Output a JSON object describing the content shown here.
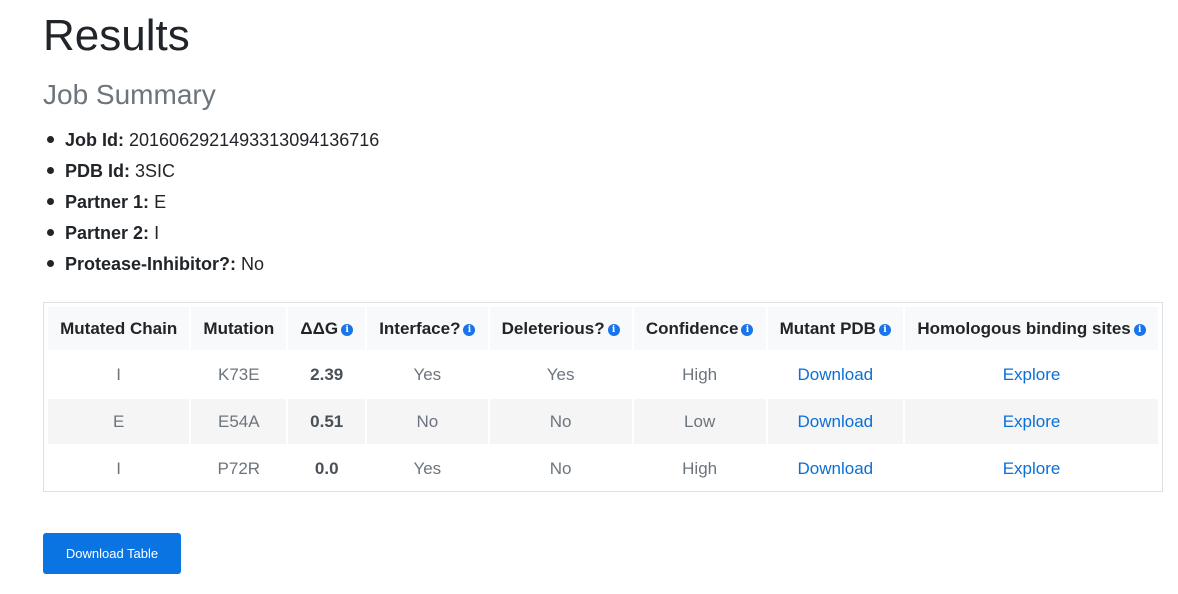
{
  "page": {
    "title": "Results",
    "section_title": "Job Summary"
  },
  "summary": [
    {
      "label": "Job Id:",
      "value": "20160629214933130941367​16"
    },
    {
      "label": "PDB Id:",
      "value": "3SIC"
    },
    {
      "label": "Partner 1:",
      "value": "E"
    },
    {
      "label": "Partner 2:",
      "value": "I"
    },
    {
      "label": "Protease-Inhibitor?:",
      "value": "No"
    }
  ],
  "table": {
    "headers": [
      {
        "label": "Mutated Chain",
        "info": false
      },
      {
        "label": "Mutation",
        "info": false
      },
      {
        "label": "ΔΔG",
        "info": true
      },
      {
        "label": "Interface?",
        "info": true
      },
      {
        "label": "Deleterious?",
        "info": true
      },
      {
        "label": "Confidence",
        "info": true
      },
      {
        "label": "Mutant PDB",
        "info": true
      },
      {
        "label": "Homologous binding sites",
        "info": true
      }
    ],
    "rows": [
      [
        "I",
        "K73E",
        "2.39",
        "Yes",
        "Yes",
        "High",
        "Download",
        "Explore"
      ],
      [
        "E",
        "E54A",
        "0.51",
        "No",
        "No",
        "Low",
        "Download",
        "Explore"
      ],
      [
        "I",
        "P72R",
        "0.0",
        "Yes",
        "No",
        "High",
        "Download",
        "Explore"
      ]
    ]
  },
  "info_icon_glyph": "i",
  "buttons": {
    "download_table": "Download Table"
  },
  "colors": {
    "accent": "#0a74e3",
    "link": "#0a6fd6",
    "info_icon": "#1a73e8"
  }
}
